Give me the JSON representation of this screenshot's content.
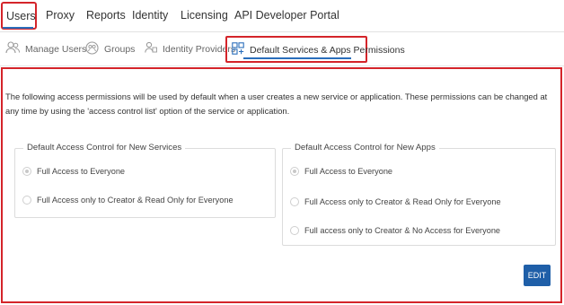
{
  "topnav": {
    "items": [
      {
        "label": "Users"
      },
      {
        "label": "Proxy"
      },
      {
        "label": "Reports"
      },
      {
        "label": "Identity"
      },
      {
        "label": "Licensing"
      },
      {
        "label": "API Developer Portal"
      }
    ],
    "active_index": 0
  },
  "subtabs": {
    "items": [
      {
        "label": "Manage Users",
        "icon": "users-icon"
      },
      {
        "label": "Groups",
        "icon": "groups-icon"
      },
      {
        "label": "Identity Providers",
        "icon": "identity-providers-icon"
      },
      {
        "label": "Default Services & Apps Permissions",
        "icon": "permissions-icon"
      }
    ],
    "active_index": 3
  },
  "content": {
    "description": "The following access permissions will be used by default when a user creates a new service or application. These permissions can be changed at any time by using the 'access control list' option of the service or application.",
    "services": {
      "title": "Default Access Control for New Services",
      "options": [
        {
          "label": "Full Access to Everyone",
          "checked": true
        },
        {
          "label": "Full Access only to Creator & Read Only for Everyone",
          "checked": false
        }
      ]
    },
    "apps": {
      "title": "Default Access Control for New Apps",
      "options": [
        {
          "label": "Full Access to Everyone",
          "checked": true
        },
        {
          "label": "Full Access only to Creator & Read Only for Everyone",
          "checked": false
        },
        {
          "label": "Full access only to Creator & No Access for Everyone",
          "checked": false
        }
      ]
    },
    "edit_label": "EDIT"
  },
  "colors": {
    "highlight_red": "#d4242a",
    "accent_blue": "#2a6ebb",
    "button_blue": "#1f5fa8"
  }
}
